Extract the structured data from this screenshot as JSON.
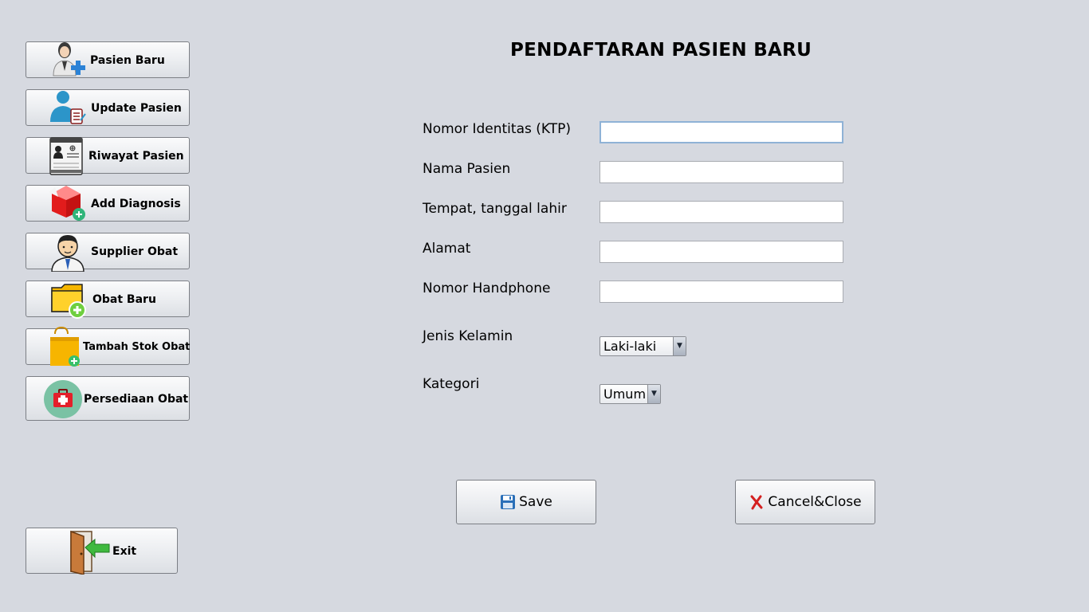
{
  "title": "PENDAFTARAN PASIEN BARU",
  "sidebar": {
    "items": [
      {
        "label": "Pasien Baru",
        "icon": "add-patient-icon"
      },
      {
        "label": "Update Pasien",
        "icon": "update-patient-icon"
      },
      {
        "label": "Riwayat Pasien",
        "icon": "patient-record-icon"
      },
      {
        "label": "Add Diagnosis",
        "icon": "diagnosis-box-icon"
      },
      {
        "label": "Supplier Obat",
        "icon": "supplier-person-icon"
      },
      {
        "label": "Obat Baru",
        "icon": "new-folder-icon"
      },
      {
        "label": "Tambah Stok Obat",
        "icon": "shopping-bag-add-icon"
      },
      {
        "label": "Persediaan Obat",
        "icon": "first-aid-kit-icon"
      }
    ],
    "exit_label": "Exit"
  },
  "form": {
    "fields": [
      {
        "label": "Nomor Identitas (KTP)",
        "value": ""
      },
      {
        "label": "Nama Pasien",
        "value": ""
      },
      {
        "label": "Tempat, tanggal lahir",
        "value": ""
      },
      {
        "label": "Alamat",
        "value": ""
      },
      {
        "label": "Nomor Handphone",
        "value": ""
      }
    ],
    "gender": {
      "label": "Jenis Kelamin",
      "selected": "Laki-laki"
    },
    "category": {
      "label": "Kategori",
      "selected": "Umum"
    }
  },
  "actions": {
    "save_label": "Save",
    "cancel_label": "Cancel&Close"
  },
  "colors": {
    "background": "#d6d9e0",
    "button_face": "#eceef1",
    "focus_border": "#8fb2d6",
    "cancel_icon": "#d42020",
    "save_icon": "#2a6fb8"
  }
}
